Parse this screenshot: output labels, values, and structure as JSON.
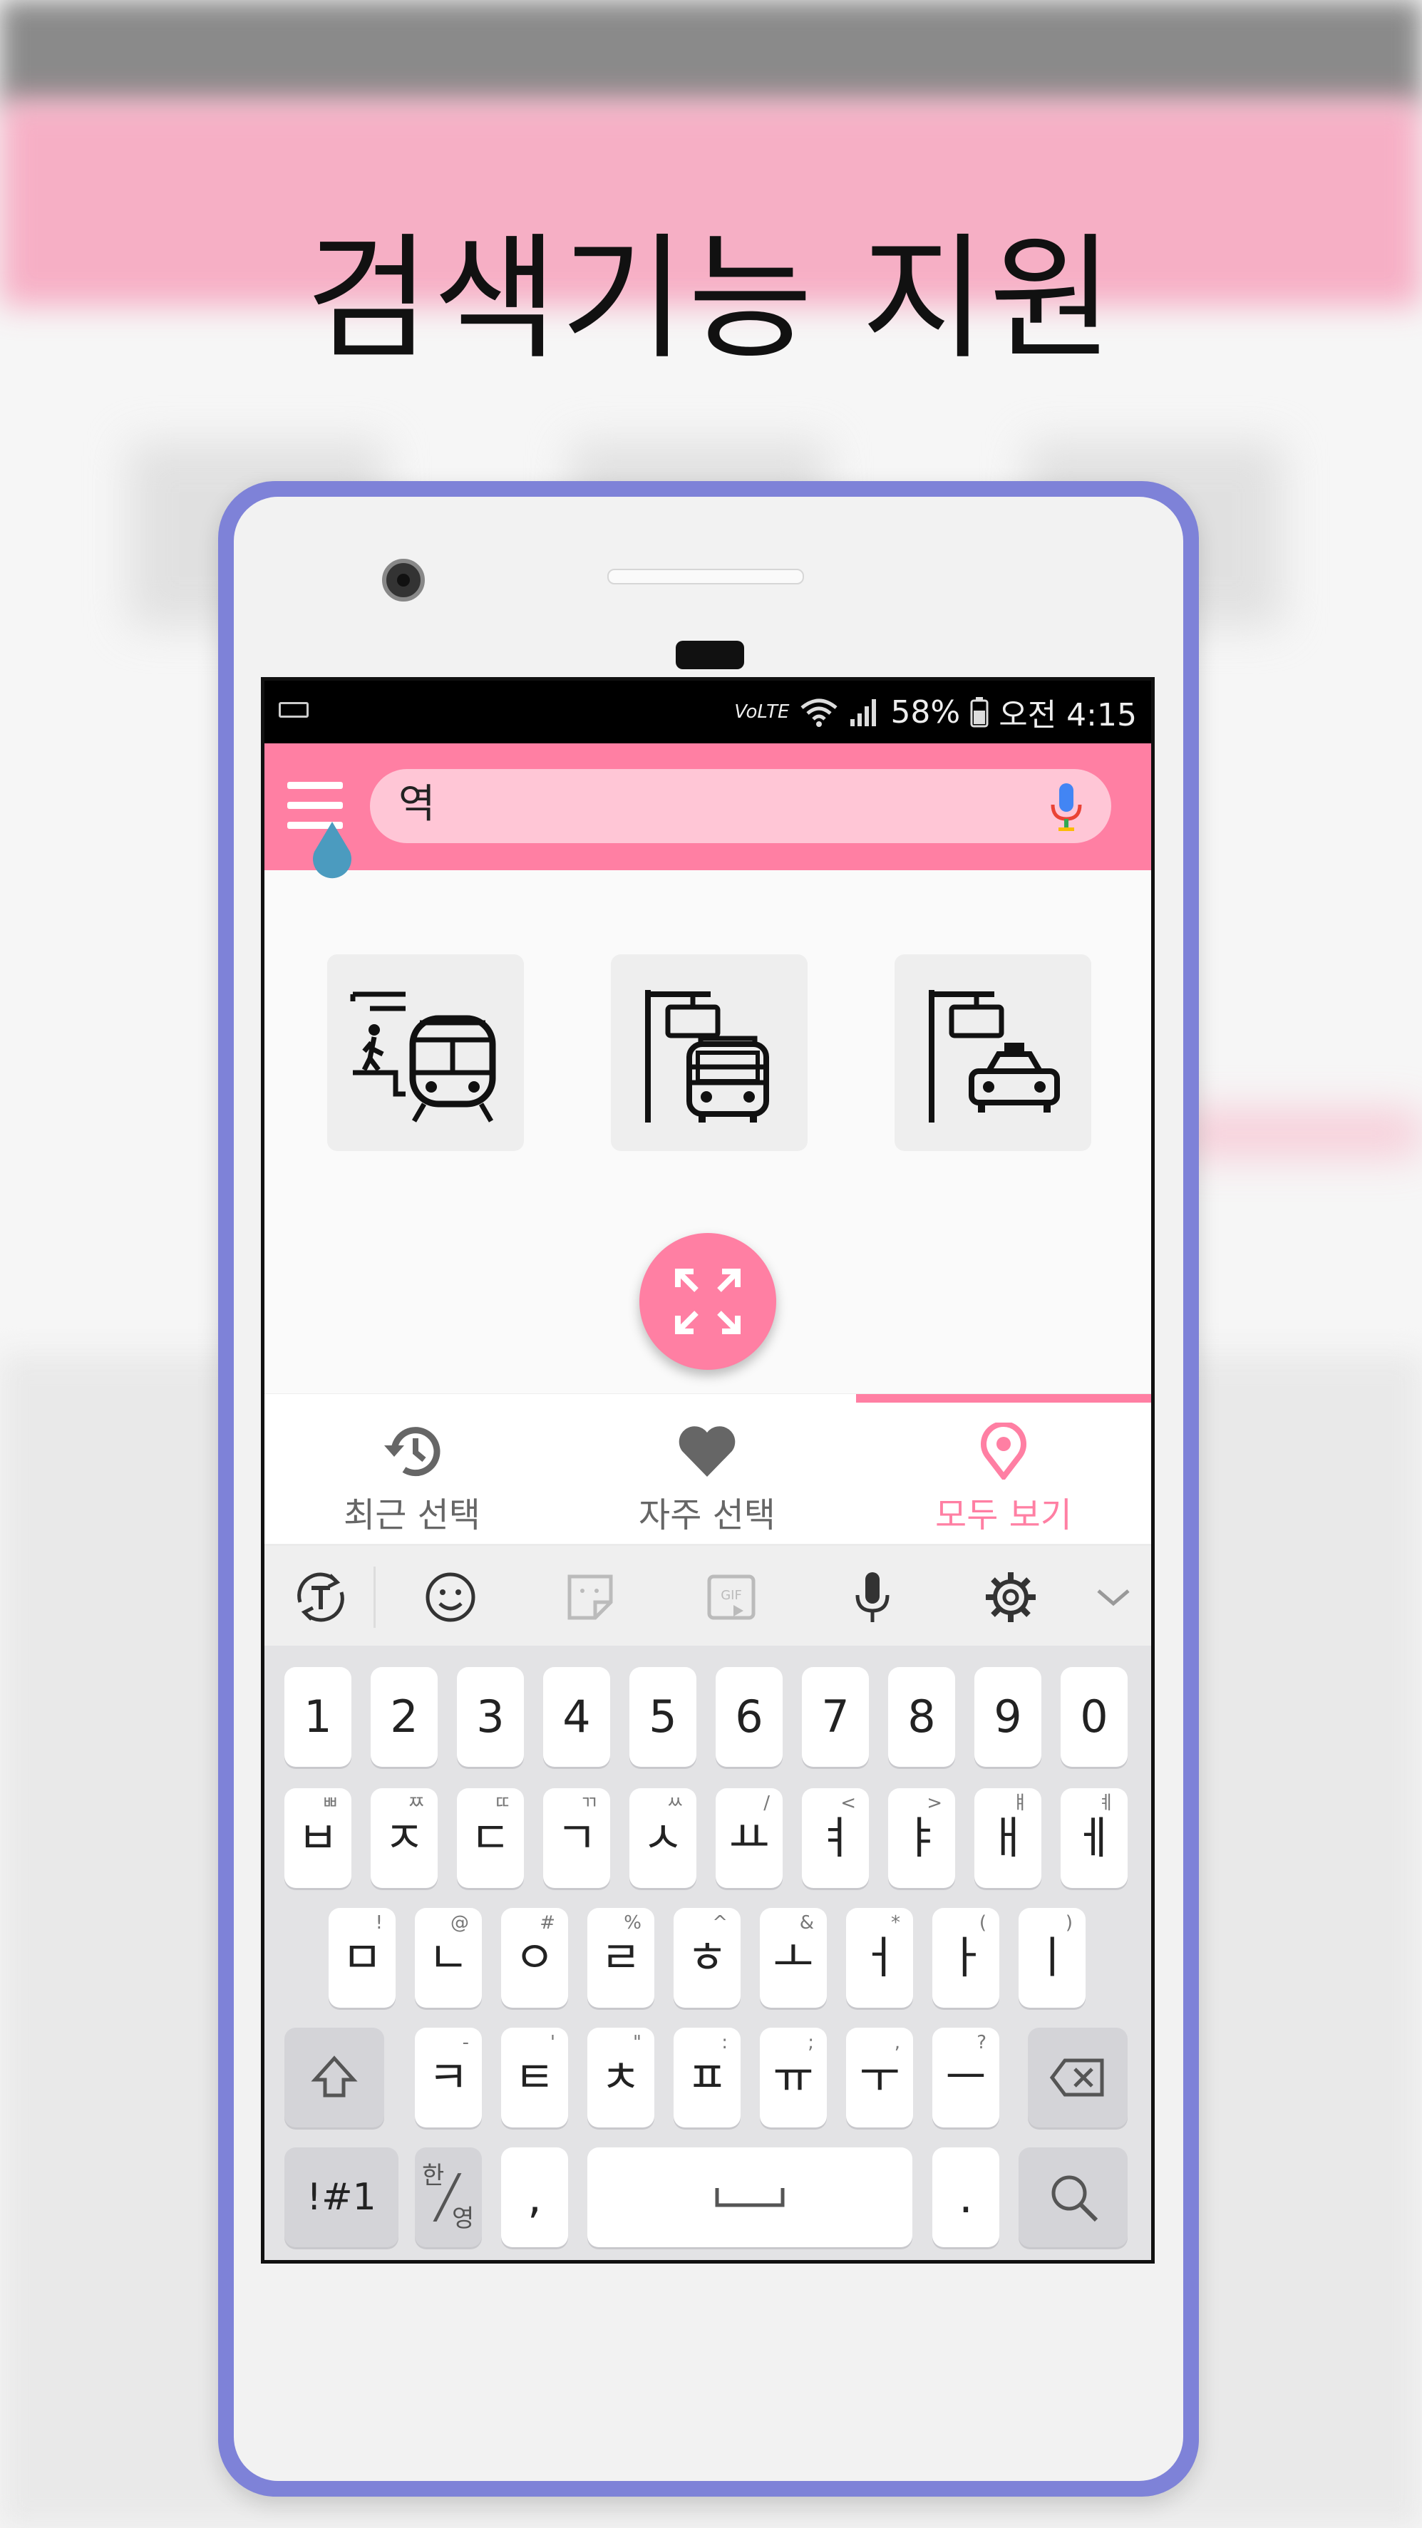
{
  "headline": "검색기능 지원",
  "status_bar": {
    "volte": "VoLTE",
    "battery": "58%",
    "time": "오전 4:15"
  },
  "search": {
    "value": "역"
  },
  "shortcuts": [
    {
      "name": "subway-station"
    },
    {
      "name": "bus-stop"
    },
    {
      "name": "taxi-stand"
    }
  ],
  "tabs": [
    {
      "label": "최근 선택",
      "icon": "history-icon"
    },
    {
      "label": "자주 선택",
      "icon": "heart-icon"
    },
    {
      "label": "모두 보기",
      "icon": "location-pin-icon",
      "active": true
    }
  ],
  "keyboard": {
    "toolbar": [
      "text-mode-icon",
      "emoji-icon",
      "sticker-icon",
      "gif-icon",
      "mic-icon",
      "gear-icon",
      "chevron-down-icon"
    ],
    "row1": [
      "1",
      "2",
      "3",
      "4",
      "5",
      "6",
      "7",
      "8",
      "9",
      "0"
    ],
    "row2": [
      {
        "k": "ㅂ",
        "s": "ㅃ"
      },
      {
        "k": "ㅈ",
        "s": "ㅉ"
      },
      {
        "k": "ㄷ",
        "s": "ㄸ"
      },
      {
        "k": "ㄱ",
        "s": "ㄲ"
      },
      {
        "k": "ㅅ",
        "s": "ㅆ"
      },
      {
        "k": "ㅛ",
        "s": "/"
      },
      {
        "k": "ㅕ",
        "s": "<"
      },
      {
        "k": "ㅑ",
        "s": ">"
      },
      {
        "k": "ㅐ",
        "s": "ㅒ"
      },
      {
        "k": "ㅔ",
        "s": "ㅖ"
      }
    ],
    "row3": [
      {
        "k": "ㅁ",
        "s": "!"
      },
      {
        "k": "ㄴ",
        "s": "@"
      },
      {
        "k": "ㅇ",
        "s": "#"
      },
      {
        "k": "ㄹ",
        "s": "%"
      },
      {
        "k": "ㅎ",
        "s": "^"
      },
      {
        "k": "ㅗ",
        "s": "&"
      },
      {
        "k": "ㅓ",
        "s": "*"
      },
      {
        "k": "ㅏ",
        "s": "("
      },
      {
        "k": "ㅣ",
        "s": ")"
      }
    ],
    "row4": [
      {
        "k": "ㅋ",
        "s": "-"
      },
      {
        "k": "ㅌ",
        "s": "'"
      },
      {
        "k": "ㅊ",
        "s": "\""
      },
      {
        "k": "ㅍ",
        "s": ":"
      },
      {
        "k": "ㅠ",
        "s": ";"
      },
      {
        "k": "ㅜ",
        "s": ","
      },
      {
        "k": "ㅡ",
        "s": "?"
      }
    ],
    "symbols_label": "!#1",
    "lang_label_top": "한",
    "lang_label_bottom": "영",
    "comma_label": ",",
    "period_label": "."
  },
  "colors": {
    "accent": "#ff7fa3",
    "searchbox": "#ffc6d6",
    "frame": "#7e82d8",
    "cursor": "#4b9bbf"
  }
}
